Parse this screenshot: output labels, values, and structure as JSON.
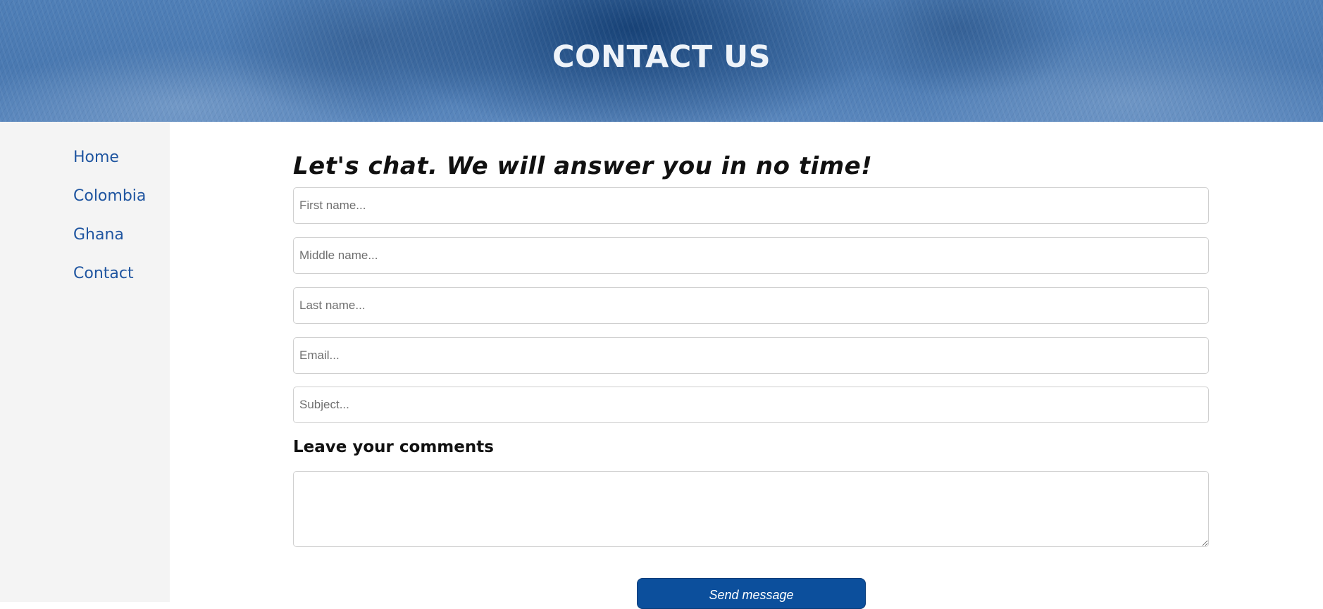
{
  "header": {
    "title": "CONTACT US"
  },
  "sidebar": {
    "items": [
      {
        "label": "Home"
      },
      {
        "label": "Colombia"
      },
      {
        "label": "Ghana"
      },
      {
        "label": "Contact"
      }
    ]
  },
  "form": {
    "heading": "Let's chat. We will answer you in no time!",
    "fields": [
      {
        "placeholder": "First name...",
        "value": ""
      },
      {
        "placeholder": "Middle name...",
        "value": ""
      },
      {
        "placeholder": "Last name...",
        "value": ""
      },
      {
        "placeholder": "Email...",
        "value": ""
      },
      {
        "placeholder": "Subject...",
        "value": ""
      }
    ],
    "comments_label": "Leave your comments",
    "comments_value": "",
    "submit_label": "Send message"
  },
  "colors": {
    "brand_blue": "#0c4f9c",
    "link_blue": "#1f55a0",
    "sidebar_bg": "#f4f4f4"
  }
}
